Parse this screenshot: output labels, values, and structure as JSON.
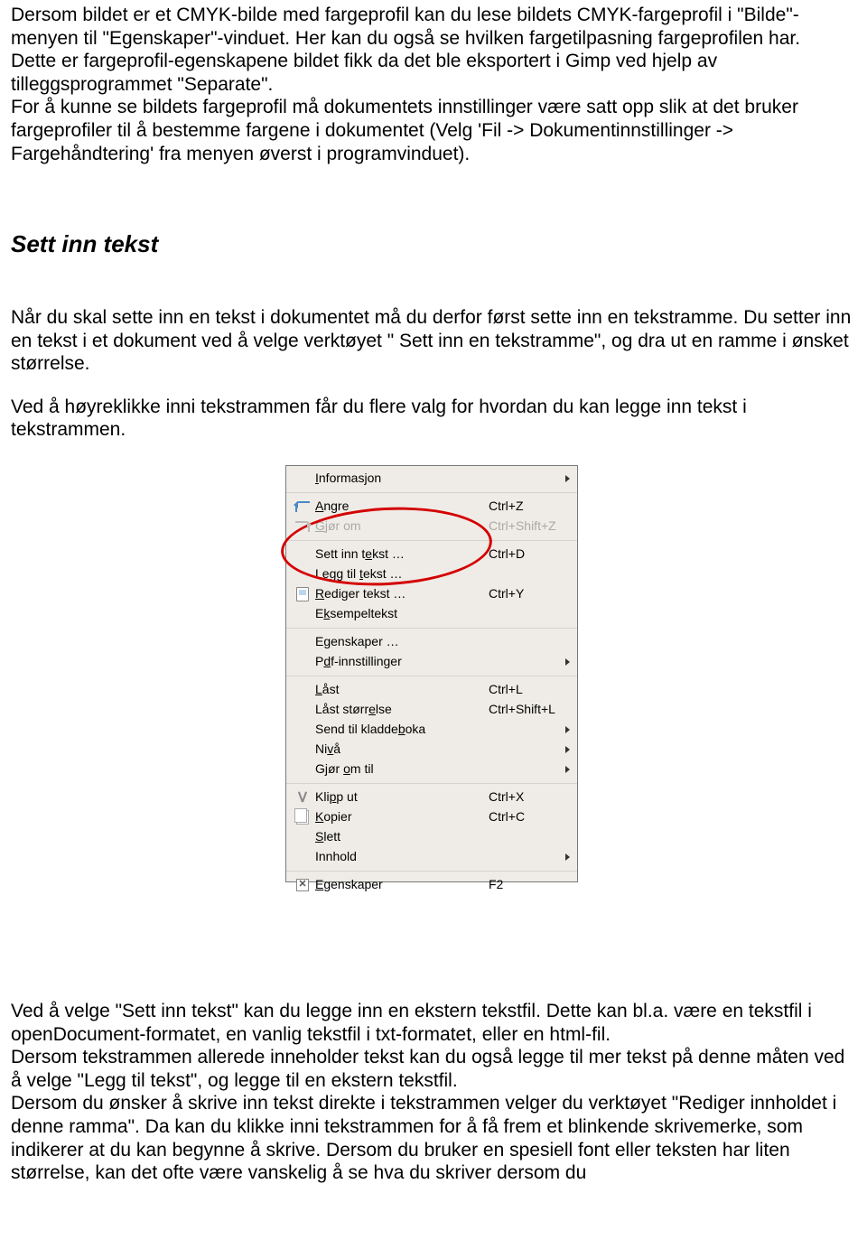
{
  "para1": "Dersom bildet er et CMYK-bilde med fargeprofil kan du lese bildets CMYK-fargeprofil i \"Bilde\"-menyen til \"Egenskaper\"-vinduet. Her kan du også se hvilken fargetilpasning fargeprofilen har.",
  "para2": "Dette er fargeprofil-egenskapene bildet fikk da det ble eksportert i Gimp ved hjelp av tilleggsprogrammet \"Separate\".",
  "para3": "For å kunne se bildets fargeprofil må dokumentets innstillinger være satt opp slik at det bruker fargeprofiler til å bestemme fargene i dokumentet (Velg 'Fil -> Dokumentinnstillinger -> Fargehåndtering' fra menyen øverst i programvinduet).",
  "heading": "Sett inn tekst",
  "para4": "Når du skal sette inn en tekst i dokumentet må du derfor først sette inn en tekstramme. Du setter inn en tekst i et dokument ved å velge verktøyet \" Sett inn en tekstramme\", og dra ut en ramme i ønsket størrelse.",
  "para5": "Ved å høyreklikke inni tekstrammen får du flere valg for hvordan du kan legge inn tekst i tekstrammen.",
  "menu": {
    "items": [
      {
        "label_pre": "",
        "u": "I",
        "label_post": "nformasjon",
        "shortcut": "",
        "submenu": true,
        "disabled": false,
        "icon": ""
      },
      {
        "sep": true
      },
      {
        "label_pre": "",
        "u": "A",
        "label_post": "ngre",
        "shortcut": "Ctrl+Z",
        "submenu": false,
        "disabled": false,
        "icon": "undo"
      },
      {
        "label_pre": "",
        "u": "G",
        "label_post": "jør om",
        "shortcut": "Ctrl+Shift+Z",
        "submenu": false,
        "disabled": true,
        "icon": "redo"
      },
      {
        "sep": true
      },
      {
        "label_pre": "Sett inn t",
        "u": "e",
        "label_post": "kst …",
        "shortcut": "Ctrl+D",
        "submenu": false,
        "disabled": false,
        "icon": ""
      },
      {
        "label_pre": "Legg til ",
        "u": "t",
        "label_post": "ekst …",
        "shortcut": "",
        "submenu": false,
        "disabled": false,
        "icon": ""
      },
      {
        "label_pre": "",
        "u": "R",
        "label_post": "ediger tekst …",
        "shortcut": "Ctrl+Y",
        "submenu": false,
        "disabled": false,
        "icon": "doc"
      },
      {
        "label_pre": "E",
        "u": "k",
        "label_post": "sempeltekst",
        "shortcut": "",
        "submenu": false,
        "disabled": false,
        "icon": ""
      },
      {
        "sep": true
      },
      {
        "label_pre": "E",
        "u": "g",
        "label_post": "enskaper …",
        "shortcut": "",
        "submenu": false,
        "disabled": false,
        "icon": ""
      },
      {
        "label_pre": "P",
        "u": "d",
        "label_post": "f-innstillinger",
        "shortcut": "",
        "submenu": true,
        "disabled": false,
        "icon": ""
      },
      {
        "sep": true
      },
      {
        "label_pre": "",
        "u": "L",
        "label_post": "åst",
        "shortcut": "Ctrl+L",
        "submenu": false,
        "disabled": false,
        "icon": ""
      },
      {
        "label_pre": "Låst størr",
        "u": "e",
        "label_post": "lse",
        "shortcut": "Ctrl+Shift+L",
        "submenu": false,
        "disabled": false,
        "icon": ""
      },
      {
        "label_pre": "Send til kladde",
        "u": "b",
        "label_post": "oka",
        "shortcut": "",
        "submenu": true,
        "disabled": false,
        "icon": ""
      },
      {
        "label_pre": "Ni",
        "u": "v",
        "label_post": "å",
        "shortcut": "",
        "submenu": true,
        "disabled": false,
        "icon": ""
      },
      {
        "label_pre": "Gjør ",
        "u": "o",
        "label_post": "m til",
        "shortcut": "",
        "submenu": true,
        "disabled": false,
        "icon": ""
      },
      {
        "sep": true
      },
      {
        "label_pre": "Kli",
        "u": "p",
        "label_post": "p ut",
        "shortcut": "Ctrl+X",
        "submenu": false,
        "disabled": false,
        "icon": "cut"
      },
      {
        "label_pre": "",
        "u": "K",
        "label_post": "opier",
        "shortcut": "Ctrl+C",
        "submenu": false,
        "disabled": false,
        "icon": "copy"
      },
      {
        "label_pre": "",
        "u": "S",
        "label_post": "lett",
        "shortcut": "",
        "submenu": false,
        "disabled": false,
        "icon": ""
      },
      {
        "label_pre": "Innhold",
        "u": "",
        "label_post": "",
        "shortcut": "",
        "submenu": true,
        "disabled": false,
        "icon": ""
      },
      {
        "sep": true
      },
      {
        "label_pre": "",
        "u": "E",
        "label_post": "genskaper",
        "shortcut": "F2",
        "submenu": false,
        "disabled": false,
        "icon": "x"
      }
    ]
  },
  "para6a": "Ved å velge \"Sett inn tekst\" kan du legge inn en ekstern tekstfil. Dette kan bl.a. være en tekstfil i openDocument-formatet, en vanlig tekstfil i txt-formatet, eller en html-fil.",
  "para6b": "Dersom tekstrammen allerede inneholder tekst kan du også legge til mer tekst på denne måten ved å velge \"Legg til tekst\", og legge til en ekstern tekstfil.",
  "para6c": "Dersom du ønsker å skrive inn tekst direkte i tekstrammen velger du verktøyet \"Rediger innholdet i denne ramma\". Da kan du klikke inni tekstrammen for å få frem et blinkende skrivemerke, som indikerer at du kan begynne å skrive. Dersom du bruker en spesiell font eller teksten har liten størrelse, kan det ofte være vanskelig å se hva du skriver dersom du"
}
